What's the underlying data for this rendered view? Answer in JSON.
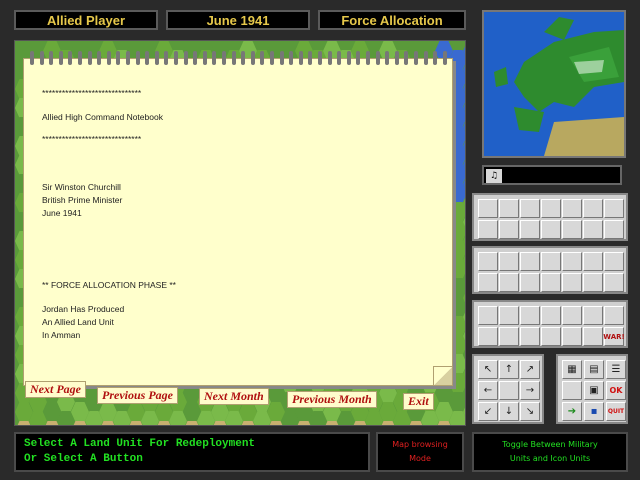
{
  "header": {
    "player": "Allied Player",
    "date": "June 1941",
    "phase": "Force Allocation"
  },
  "notebook": {
    "stars1": "******************************",
    "title": "Allied High Command Notebook",
    "stars2": "******************************",
    "name": "Sir Winston Churchill",
    "role": "British Prime Minister",
    "date": "June 1941",
    "phase": "** FORCE ALLOCATION PHASE **",
    "msg1": "Jordan Has Produced",
    "msg2": "An Allied Land Unit",
    "msg3": "In Amman",
    "tabs": [
      "Next Page",
      "Previous Page",
      "Next Month",
      "Previous Month",
      "Exit"
    ]
  },
  "status": {
    "line1": "Select A Land Unit For Redeployment",
    "line2": "Or Select A Button",
    "mode1": "Map browsing",
    "mode2": "Mode",
    "toggle1": "Toggle Between Military",
    "toggle2": "Units and Icon Units"
  },
  "buttons": {
    "ok": "OK",
    "quit": "QUIT",
    "war": "WAR!"
  },
  "colors": {
    "header_text": "#e6c84a",
    "status_green": "#22e022",
    "mode_red": "#e02020",
    "tab_red": "#b01010",
    "sea": "#2060c8"
  }
}
